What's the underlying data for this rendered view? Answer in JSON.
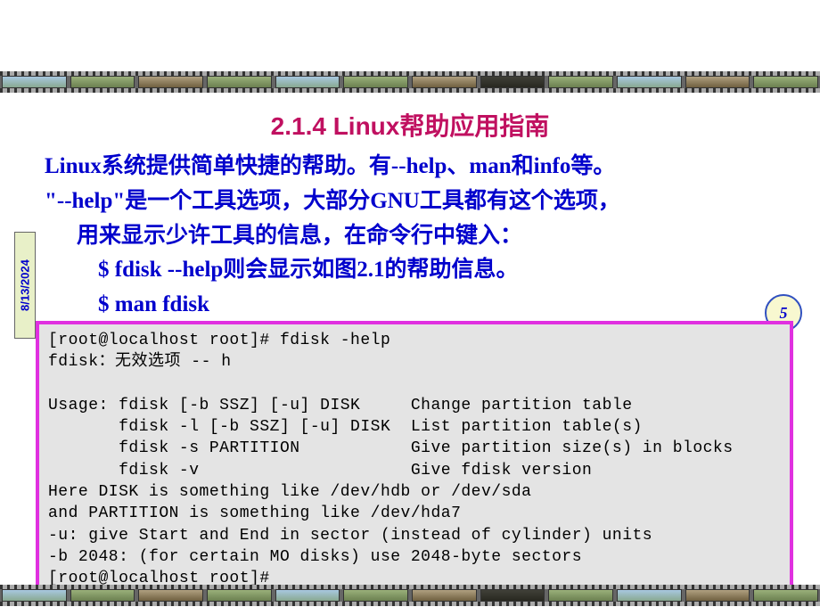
{
  "date": "8/13/2024",
  "page_number": "5",
  "title": "2.1.4 Linux帮助应用指南",
  "para": {
    "l1": "Linux系统提供简单快捷的帮助。有--help、man和info等。",
    "l2": "\"--help\"是一个工具选项，大部分GNU工具都有这个选项，",
    "l3": "用来显示少许工具的信息，在命令行中键入：",
    "l4": "$ fdisk --help则会显示如图2.1的帮助信息。",
    "l5": "$ man fdisk"
  },
  "terminal": {
    "l1": "[root@localhost root]# fdisk -help",
    "l2": "fdisk：无效选项 -- h",
    "l3": "",
    "l4": "Usage: fdisk [-b SSZ] [-u] DISK     Change partition table",
    "l5": "       fdisk -l [-b SSZ] [-u] DISK  List partition table(s)",
    "l6": "       fdisk -s PARTITION           Give partition size(s) in blocks",
    "l7": "       fdisk -v                     Give fdisk version",
    "l8": "Here DISK is something like /dev/hdb or /dev/sda",
    "l9": "and PARTITION is something like /dev/hda7",
    "l10": "-u: give Start and End in sector (instead of cylinder) units",
    "l11": "-b 2048: (for certain MO disks) use 2048-byte sectors",
    "l12": "[root@localhost root]#"
  }
}
